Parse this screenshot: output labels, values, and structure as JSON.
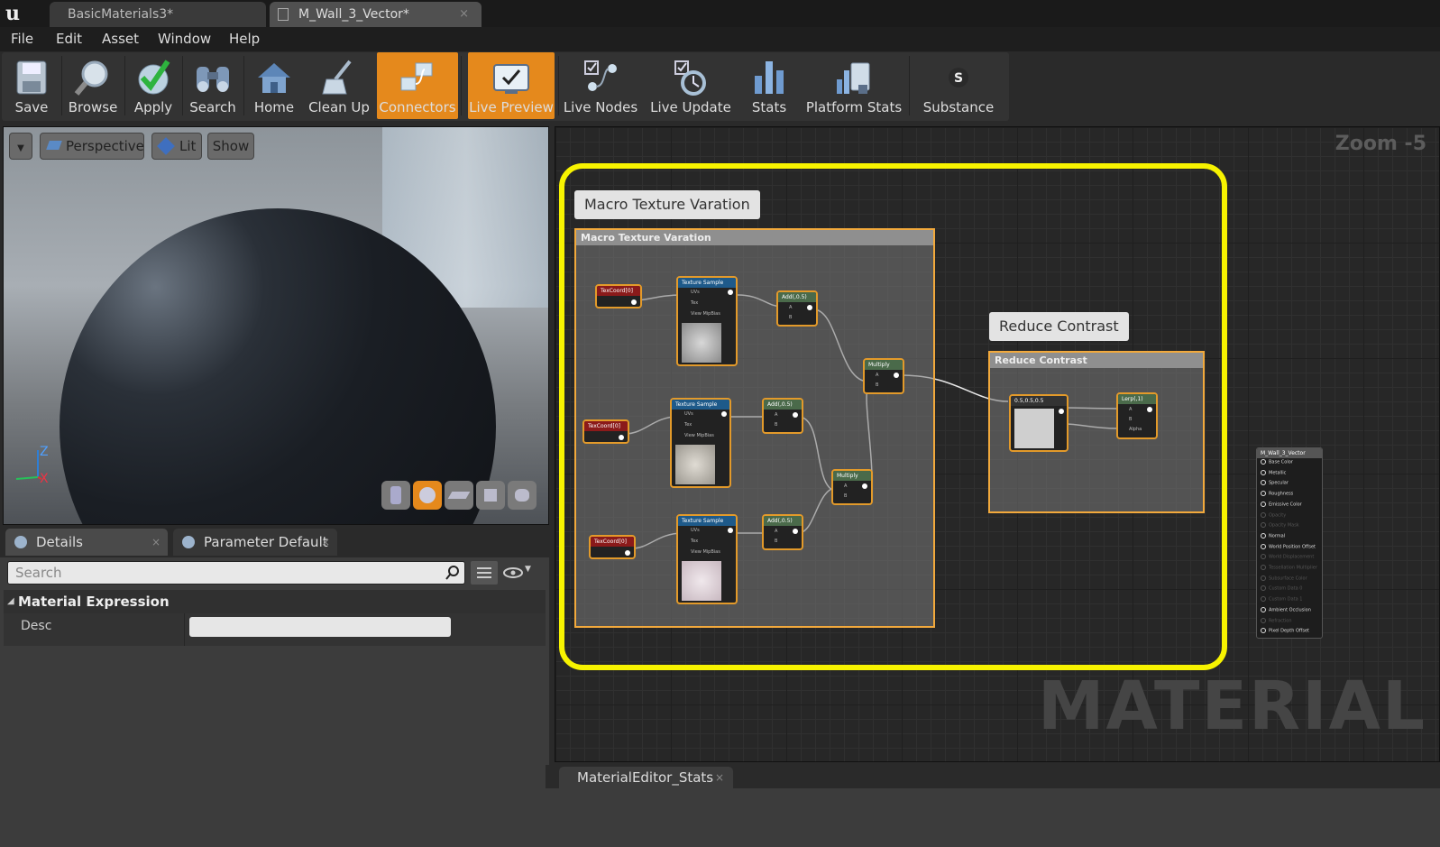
{
  "tabs": {
    "logo": "u",
    "doc1": "BasicMaterials3*",
    "doc2": "M_Wall_3_Vector*",
    "close": "×"
  },
  "menu": [
    "File",
    "Edit",
    "Asset",
    "Window",
    "Help"
  ],
  "toolbar": {
    "save": "Save",
    "browse": "Browse",
    "apply": "Apply",
    "search": "Search",
    "home": "Home",
    "cleanup": "Clean Up",
    "connectors": "Connectors",
    "livepreview": "Live Preview",
    "livenodes": "Live Nodes",
    "liveupdate": "Live Update",
    "stats": "Stats",
    "platformstats": "Platform Stats",
    "substance": "Substance"
  },
  "viewport": {
    "perspective": "Perspective",
    "lit": "Lit",
    "show": "Show",
    "axis_z": "Z",
    "axis_x": "X"
  },
  "details": {
    "tab_details": "Details",
    "tab_params": "Parameter Default",
    "search_placeholder": "Search",
    "category": "Material Expression",
    "desc_label": "Desc",
    "desc_value": ""
  },
  "graph": {
    "zoom": "Zoom -5",
    "watermark": "MATERIAL",
    "comment1_bubble": "Macro Texture Varation",
    "comment1_title": "Macro Texture Varation",
    "comment2_bubble": "Reduce Contrast",
    "comment2_title": "Reduce Contrast",
    "nodes": {
      "texcoord": "TexCoord[0]",
      "texsample": "Texture Sample",
      "add": "Add(,0.5)",
      "multiply": "Multiply",
      "constant": "0.5,0.5,0.5",
      "lerp": "Lerp(,1)",
      "result": "M_Wall_3_Vector",
      "pin_uvs": "UVs",
      "pin_tex": "Tex",
      "pin_mip": "View MipBias",
      "pin_a": "A",
      "pin_b": "B",
      "pin_alpha": "Alpha"
    },
    "result_pins": [
      "Base Color",
      "Metallic",
      "Specular",
      "Roughness",
      "Emissive Color",
      "Opacity",
      "Opacity Mask",
      "Normal",
      "World Position Offset",
      "World Displacement",
      "Tessellation Multiplier",
      "Subsurface Color",
      "Custom Data 0",
      "Custom Data 1",
      "Ambient Occlusion",
      "Refraction",
      "Pixel Depth Offset"
    ]
  },
  "stats_tab": "MaterialEditor_Stats",
  "colors": {
    "accent": "#e5891c",
    "highlight": "#f7f300",
    "node_border": "#e39a2a",
    "texcoord_header": "#8b1a1a",
    "texsample_header": "#1e5a8a",
    "math_header": "#4a6a4a"
  }
}
